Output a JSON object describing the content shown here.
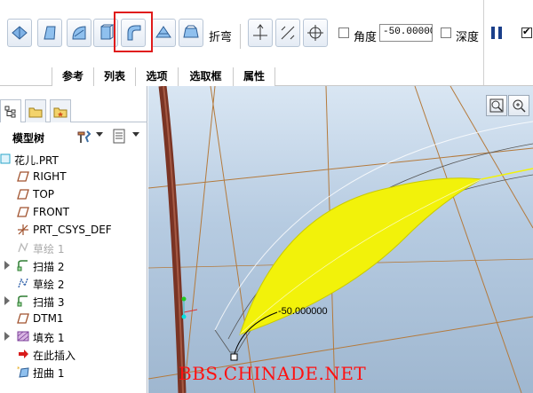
{
  "toolbar": {
    "fold_label": "折弯",
    "angle_label": "角度",
    "angle_value": "-50.00000",
    "depth_label": "深度",
    "checkbox_last_checked": true,
    "highlight_color": "#e01b1b"
  },
  "tabs": [
    {
      "label": "参考"
    },
    {
      "label": "列表"
    },
    {
      "label": "选项"
    },
    {
      "label": "选取框"
    },
    {
      "label": "属性"
    }
  ],
  "panel": {
    "title": "模型树",
    "items": [
      {
        "label": "花儿.PRT",
        "icon": "part-icon",
        "dim": false
      },
      {
        "label": "RIGHT",
        "icon": "datum-plane-icon",
        "dim": false
      },
      {
        "label": "TOP",
        "icon": "datum-plane-icon",
        "dim": false
      },
      {
        "label": "FRONT",
        "icon": "datum-plane-icon",
        "dim": false
      },
      {
        "label": "PRT_CSYS_DEF",
        "icon": "csys-icon",
        "dim": false
      },
      {
        "label": "草绘 1",
        "icon": "sketch-icon",
        "dim": true
      },
      {
        "label": "扫描 2",
        "icon": "sweep-icon",
        "dim": false
      },
      {
        "label": "草绘 2",
        "icon": "sketch-icon",
        "dim": false
      },
      {
        "label": "扫描 3",
        "icon": "sweep-icon",
        "dim": false
      },
      {
        "label": "DTM1",
        "icon": "datum-plane-icon",
        "dim": false
      },
      {
        "label": "填充 1",
        "icon": "fill-icon",
        "dim": false
      },
      {
        "label": "在此插入",
        "icon": "insert-here-icon",
        "dim": false
      },
      {
        "label": "扭曲 1",
        "icon": "warp-icon",
        "dim": false
      }
    ]
  },
  "viewport": {
    "dimension_text": "-50.000000",
    "watermark": "BBS.CHINADE.NET",
    "surface_color": "#f2f20a",
    "background_color": "#b6cbe1"
  }
}
